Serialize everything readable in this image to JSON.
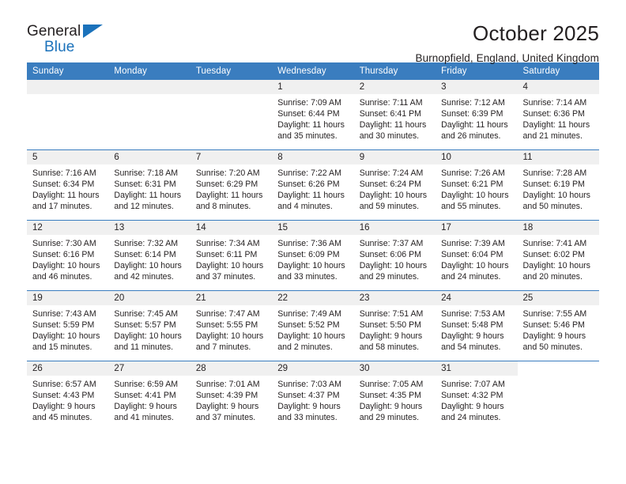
{
  "brand": {
    "name_part1": "General",
    "name_part2": "Blue",
    "triangle_color": "#1b72bb"
  },
  "header": {
    "title": "October 2025",
    "subtitle": "Burnopfield, England, United Kingdom"
  },
  "theme": {
    "header_row_bg": "#3a7dbf",
    "daynum_bg": "#f0f0f0",
    "text": "#231f20"
  },
  "calendar": {
    "weekdays": [
      "Sunday",
      "Monday",
      "Tuesday",
      "Wednesday",
      "Thursday",
      "Friday",
      "Saturday"
    ],
    "labels": {
      "sunrise": "Sunrise:",
      "sunset": "Sunset:",
      "daylight": "Daylight:"
    },
    "weeks": [
      [
        {
          "day": "",
          "state": "blank"
        },
        {
          "day": "",
          "state": "blank"
        },
        {
          "day": "",
          "state": "blank"
        },
        {
          "day": "1",
          "state": "filled",
          "sunrise": "Sunrise: 7:09 AM",
          "sunset": "Sunset: 6:44 PM",
          "daylight_1": "Daylight: 11 hours",
          "daylight_2": "and 35 minutes."
        },
        {
          "day": "2",
          "state": "filled",
          "sunrise": "Sunrise: 7:11 AM",
          "sunset": "Sunset: 6:41 PM",
          "daylight_1": "Daylight: 11 hours",
          "daylight_2": "and 30 minutes."
        },
        {
          "day": "3",
          "state": "filled",
          "sunrise": "Sunrise: 7:12 AM",
          "sunset": "Sunset: 6:39 PM",
          "daylight_1": "Daylight: 11 hours",
          "daylight_2": "and 26 minutes."
        },
        {
          "day": "4",
          "state": "filled",
          "sunrise": "Sunrise: 7:14 AM",
          "sunset": "Sunset: 6:36 PM",
          "daylight_1": "Daylight: 11 hours",
          "daylight_2": "and 21 minutes."
        }
      ],
      [
        {
          "day": "5",
          "state": "filled",
          "sunrise": "Sunrise: 7:16 AM",
          "sunset": "Sunset: 6:34 PM",
          "daylight_1": "Daylight: 11 hours",
          "daylight_2": "and 17 minutes."
        },
        {
          "day": "6",
          "state": "filled",
          "sunrise": "Sunrise: 7:18 AM",
          "sunset": "Sunset: 6:31 PM",
          "daylight_1": "Daylight: 11 hours",
          "daylight_2": "and 12 minutes."
        },
        {
          "day": "7",
          "state": "filled",
          "sunrise": "Sunrise: 7:20 AM",
          "sunset": "Sunset: 6:29 PM",
          "daylight_1": "Daylight: 11 hours",
          "daylight_2": "and 8 minutes."
        },
        {
          "day": "8",
          "state": "filled",
          "sunrise": "Sunrise: 7:22 AM",
          "sunset": "Sunset: 6:26 PM",
          "daylight_1": "Daylight: 11 hours",
          "daylight_2": "and 4 minutes."
        },
        {
          "day": "9",
          "state": "filled",
          "sunrise": "Sunrise: 7:24 AM",
          "sunset": "Sunset: 6:24 PM",
          "daylight_1": "Daylight: 10 hours",
          "daylight_2": "and 59 minutes."
        },
        {
          "day": "10",
          "state": "filled",
          "sunrise": "Sunrise: 7:26 AM",
          "sunset": "Sunset: 6:21 PM",
          "daylight_1": "Daylight: 10 hours",
          "daylight_2": "and 55 minutes."
        },
        {
          "day": "11",
          "state": "filled",
          "sunrise": "Sunrise: 7:28 AM",
          "sunset": "Sunset: 6:19 PM",
          "daylight_1": "Daylight: 10 hours",
          "daylight_2": "and 50 minutes."
        }
      ],
      [
        {
          "day": "12",
          "state": "filled",
          "sunrise": "Sunrise: 7:30 AM",
          "sunset": "Sunset: 6:16 PM",
          "daylight_1": "Daylight: 10 hours",
          "daylight_2": "and 46 minutes."
        },
        {
          "day": "13",
          "state": "filled",
          "sunrise": "Sunrise: 7:32 AM",
          "sunset": "Sunset: 6:14 PM",
          "daylight_1": "Daylight: 10 hours",
          "daylight_2": "and 42 minutes."
        },
        {
          "day": "14",
          "state": "filled",
          "sunrise": "Sunrise: 7:34 AM",
          "sunset": "Sunset: 6:11 PM",
          "daylight_1": "Daylight: 10 hours",
          "daylight_2": "and 37 minutes."
        },
        {
          "day": "15",
          "state": "filled",
          "sunrise": "Sunrise: 7:36 AM",
          "sunset": "Sunset: 6:09 PM",
          "daylight_1": "Daylight: 10 hours",
          "daylight_2": "and 33 minutes."
        },
        {
          "day": "16",
          "state": "filled",
          "sunrise": "Sunrise: 7:37 AM",
          "sunset": "Sunset: 6:06 PM",
          "daylight_1": "Daylight: 10 hours",
          "daylight_2": "and 29 minutes."
        },
        {
          "day": "17",
          "state": "filled",
          "sunrise": "Sunrise: 7:39 AM",
          "sunset": "Sunset: 6:04 PM",
          "daylight_1": "Daylight: 10 hours",
          "daylight_2": "and 24 minutes."
        },
        {
          "day": "18",
          "state": "filled",
          "sunrise": "Sunrise: 7:41 AM",
          "sunset": "Sunset: 6:02 PM",
          "daylight_1": "Daylight: 10 hours",
          "daylight_2": "and 20 minutes."
        }
      ],
      [
        {
          "day": "19",
          "state": "filled",
          "sunrise": "Sunrise: 7:43 AM",
          "sunset": "Sunset: 5:59 PM",
          "daylight_1": "Daylight: 10 hours",
          "daylight_2": "and 15 minutes."
        },
        {
          "day": "20",
          "state": "filled",
          "sunrise": "Sunrise: 7:45 AM",
          "sunset": "Sunset: 5:57 PM",
          "daylight_1": "Daylight: 10 hours",
          "daylight_2": "and 11 minutes."
        },
        {
          "day": "21",
          "state": "filled",
          "sunrise": "Sunrise: 7:47 AM",
          "sunset": "Sunset: 5:55 PM",
          "daylight_1": "Daylight: 10 hours",
          "daylight_2": "and 7 minutes."
        },
        {
          "day": "22",
          "state": "filled",
          "sunrise": "Sunrise: 7:49 AM",
          "sunset": "Sunset: 5:52 PM",
          "daylight_1": "Daylight: 10 hours",
          "daylight_2": "and 2 minutes."
        },
        {
          "day": "23",
          "state": "filled",
          "sunrise": "Sunrise: 7:51 AM",
          "sunset": "Sunset: 5:50 PM",
          "daylight_1": "Daylight: 9 hours",
          "daylight_2": "and 58 minutes."
        },
        {
          "day": "24",
          "state": "filled",
          "sunrise": "Sunrise: 7:53 AM",
          "sunset": "Sunset: 5:48 PM",
          "daylight_1": "Daylight: 9 hours",
          "daylight_2": "and 54 minutes."
        },
        {
          "day": "25",
          "state": "filled",
          "sunrise": "Sunrise: 7:55 AM",
          "sunset": "Sunset: 5:46 PM",
          "daylight_1": "Daylight: 9 hours",
          "daylight_2": "and 50 minutes."
        }
      ],
      [
        {
          "day": "26",
          "state": "filled",
          "sunrise": "Sunrise: 6:57 AM",
          "sunset": "Sunset: 4:43 PM",
          "daylight_1": "Daylight: 9 hours",
          "daylight_2": "and 45 minutes."
        },
        {
          "day": "27",
          "state": "filled",
          "sunrise": "Sunrise: 6:59 AM",
          "sunset": "Sunset: 4:41 PM",
          "daylight_1": "Daylight: 9 hours",
          "daylight_2": "and 41 minutes."
        },
        {
          "day": "28",
          "state": "filled",
          "sunrise": "Sunrise: 7:01 AM",
          "sunset": "Sunset: 4:39 PM",
          "daylight_1": "Daylight: 9 hours",
          "daylight_2": "and 37 minutes."
        },
        {
          "day": "29",
          "state": "filled",
          "sunrise": "Sunrise: 7:03 AM",
          "sunset": "Sunset: 4:37 PM",
          "daylight_1": "Daylight: 9 hours",
          "daylight_2": "and 33 minutes."
        },
        {
          "day": "30",
          "state": "filled",
          "sunrise": "Sunrise: 7:05 AM",
          "sunset": "Sunset: 4:35 PM",
          "daylight_1": "Daylight: 9 hours",
          "daylight_2": "and 29 minutes."
        },
        {
          "day": "31",
          "state": "filled",
          "sunrise": "Sunrise: 7:07 AM",
          "sunset": "Sunset: 4:32 PM",
          "daylight_1": "Daylight: 9 hours",
          "daylight_2": "and 24 minutes."
        },
        {
          "day": "",
          "state": "empty"
        }
      ]
    ]
  }
}
